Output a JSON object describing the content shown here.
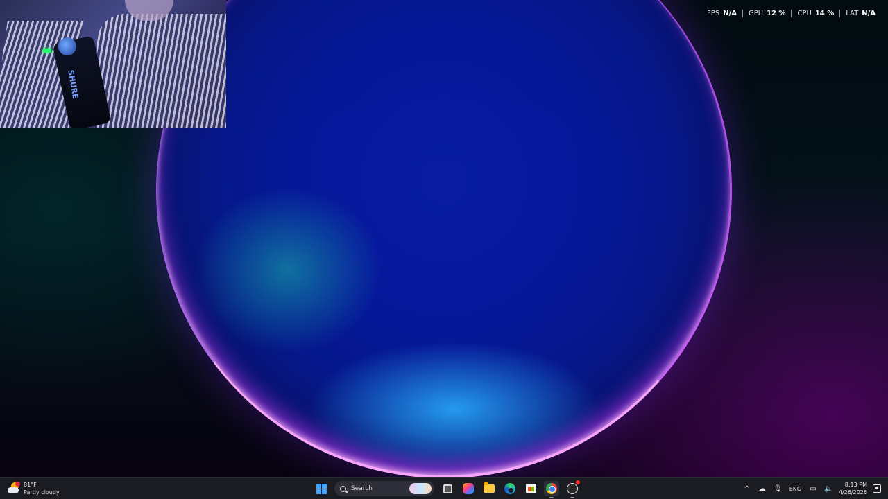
{
  "overlay": {
    "performance": [
      {
        "label": "FPS",
        "value": "N/A"
      },
      {
        "label": "GPU",
        "value": "12 %"
      },
      {
        "label": "CPU",
        "value": "14 %"
      },
      {
        "label": "LAT",
        "value": "N/A"
      }
    ],
    "webcam": {
      "brand_text": "SHURE"
    }
  },
  "taskbar": {
    "weather": {
      "temperature": "81°F",
      "condition": "Partly cloudy",
      "icon": "partly-cloudy-icon"
    },
    "search": {
      "label": "Search"
    },
    "pinned": [
      {
        "name": "start",
        "icon": "windows-logo-icon"
      },
      {
        "name": "task-view",
        "icon": "task-view-icon"
      },
      {
        "name": "copilot",
        "icon": "copilot-icon"
      },
      {
        "name": "file-explorer",
        "icon": "folder-icon"
      },
      {
        "name": "edge",
        "icon": "edge-icon"
      },
      {
        "name": "microsoft-store",
        "icon": "store-icon"
      },
      {
        "name": "chrome",
        "icon": "chrome-icon",
        "active": true
      },
      {
        "name": "obs",
        "icon": "obs-icon",
        "badge": true
      }
    ],
    "tray": {
      "language": "ENG",
      "time": "8:13 PM",
      "date": "4/26/2026"
    }
  },
  "colors": {
    "taskbar_bg": "#1b1b22",
    "start_blue": "#3ea4ff",
    "wallpaper_blue": "#0718a0",
    "wallpaper_magenta": "#b430ff"
  }
}
